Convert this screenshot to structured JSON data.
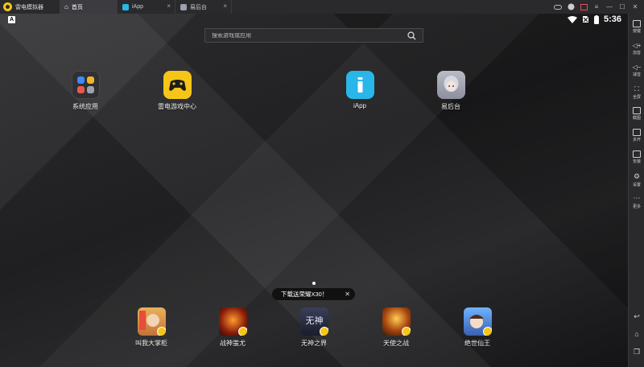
{
  "window": {
    "app_title": "雷电模拟器",
    "tabs": [
      {
        "label": "首页",
        "active": true
      },
      {
        "label": "iApp",
        "active": false
      },
      {
        "label": "易后台",
        "active": false
      }
    ]
  },
  "statusbar": {
    "left_icon": "A",
    "time": "5:36"
  },
  "search": {
    "placeholder": "搜索游戏或应用"
  },
  "apps": [
    {
      "label": "系统应用",
      "icon": "folder-icon"
    },
    {
      "label": "雷电游戏中心",
      "icon": "gamepad-icon"
    },
    {
      "label": "iApp",
      "icon": "iapp-icon"
    },
    {
      "label": "易后台",
      "icon": "anime-avatar-icon"
    }
  ],
  "promo": {
    "text": "下载送荣耀X30！",
    "close": "✕"
  },
  "games": [
    {
      "label": "叫我大掌柜"
    },
    {
      "label": "战神蚩尤"
    },
    {
      "label": "无神之界"
    },
    {
      "label": "天使之战"
    },
    {
      "label": "绝世仙王"
    }
  ],
  "sidebar": {
    "items": [
      "按键",
      "加音",
      "减音",
      "全屏",
      "截图",
      "多开",
      "安装",
      "设置",
      "更多"
    ]
  },
  "colors": {
    "accent": "#f5c518",
    "iapp": "#29b6e8"
  }
}
